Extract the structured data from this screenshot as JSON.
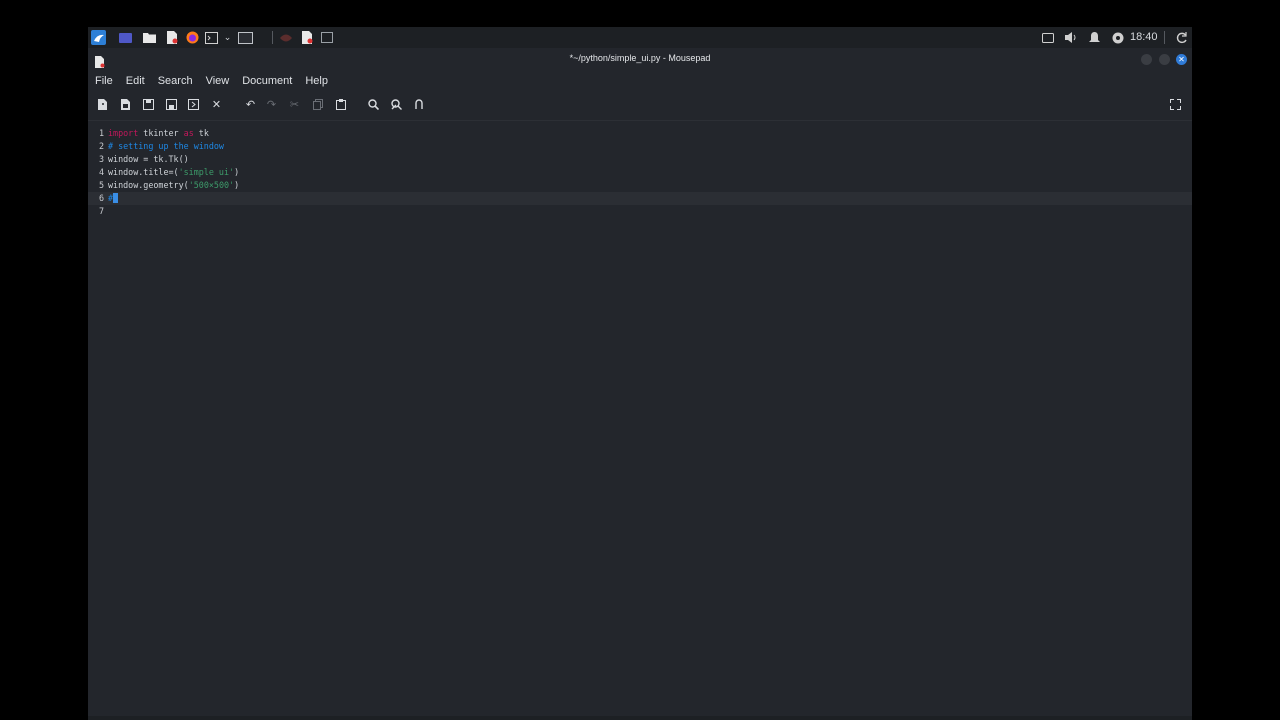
{
  "panel": {
    "clock": "18:40"
  },
  "window": {
    "title": "*~/python/simple_ui.py - Mousepad"
  },
  "menubar": {
    "items": [
      "File",
      "Edit",
      "Search",
      "View",
      "Document",
      "Help"
    ]
  },
  "editor": {
    "lines": [
      {
        "num": "1",
        "tokens": [
          {
            "t": "import",
            "c": "kw"
          },
          {
            "t": " tkinter ",
            "c": ""
          },
          {
            "t": "as",
            "c": "kw"
          },
          {
            "t": " tk",
            "c": ""
          }
        ]
      },
      {
        "num": "2",
        "tokens": [
          {
            "t": "# setting up the window",
            "c": "cm"
          }
        ]
      },
      {
        "num": "3",
        "tokens": [
          {
            "t": "window = tk.Tk()",
            "c": ""
          }
        ]
      },
      {
        "num": "4",
        "tokens": [
          {
            "t": "window.title=(",
            "c": ""
          },
          {
            "t": "'simple ui'",
            "c": "st"
          },
          {
            "t": ")",
            "c": ""
          }
        ]
      },
      {
        "num": "5",
        "tokens": [
          {
            "t": "window.geometry(",
            "c": ""
          },
          {
            "t": "'500×500'",
            "c": "st"
          },
          {
            "t": ")",
            "c": ""
          }
        ]
      },
      {
        "num": "6",
        "tokens": [
          {
            "t": "#",
            "c": "cm"
          }
        ]
      },
      {
        "num": "7",
        "tokens": []
      }
    ],
    "current_line": 6
  },
  "colors": {
    "keyword": "#c2185b",
    "comment": "#1e88e5",
    "string": "#3d9b6a",
    "background": "#23262c"
  }
}
